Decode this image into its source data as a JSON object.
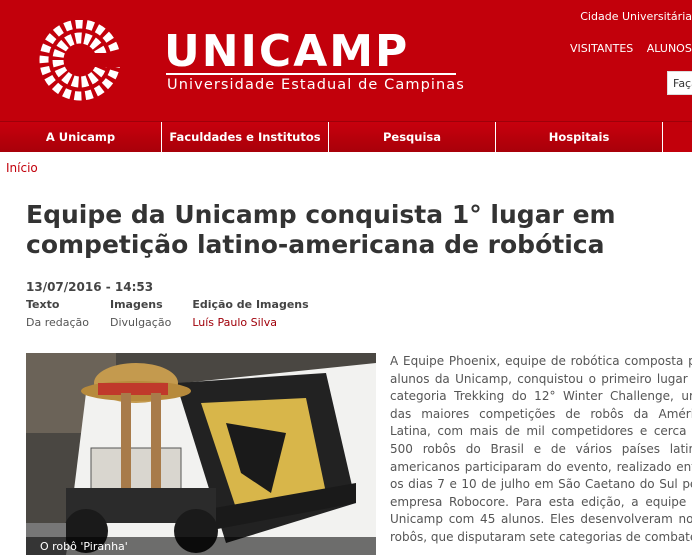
{
  "header": {
    "wordmark": "UNICAMP",
    "subtitle": "Universidade Estadual de Campinas",
    "city_link": "Cidade Universitária",
    "top_links": [
      "VISITANTES",
      "ALUNOS"
    ],
    "search_placeholder": "Faça"
  },
  "nav": {
    "items": [
      "A Unicamp",
      "Faculdades e Institutos",
      "Pesquisa",
      "Hospitais"
    ]
  },
  "breadcrumb": {
    "home": "Início"
  },
  "article": {
    "title": "Equipe da Unicamp conquista 1° lugar em competição latino-americana de robótica",
    "date": "13/07/2016 - 14:53",
    "credits": [
      {
        "label": "Texto",
        "value": "Da redação"
      },
      {
        "label": "Imagens",
        "value": "Divulgação"
      },
      {
        "label": "Edição de Imagens",
        "value": "Luís Paulo Silva"
      }
    ],
    "photo_caption": "O robô 'Piranha'",
    "body": "A Equipe Phoenix, equipe de robótica composta por alunos da Unicamp, conquistou o primeiro lugar na categoria Trekking do 12° Winter Challenge, uma das maiores competições de robôs da América Latina, com mais de mil competidores e cerca de 500 robôs do Brasil e de vários países latino-americanos participaram do evento, realizado entre os dias 7 e 10 de julho em São Caetano do Sul pela empresa Robocore. Para esta edição, a equipe da Unicamp com 45 alunos. Eles desenvolveram nove robôs, que disputaram sete categorias de combates."
  },
  "colors": {
    "brand_red": "#c2000b",
    "link_red": "#a0000a"
  }
}
